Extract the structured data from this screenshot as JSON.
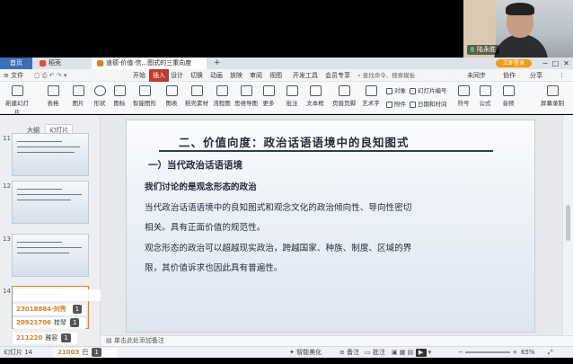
{
  "video": {
    "name": "陆永胜"
  },
  "tabs": {
    "home": "首页",
    "doke": "稻壳",
    "doc": "道德·价值·信...图式的三重向度",
    "plus": "+"
  },
  "login": "立即登录",
  "menu": {
    "file": "文件",
    "items": [
      "开始",
      "插入",
      "设计",
      "切换",
      "动画",
      "放映",
      "审阅",
      "视图",
      "开发工具",
      "会员专享"
    ],
    "search": "查找命令、搜索模板",
    "right": [
      "未同步",
      "协作",
      "分享"
    ]
  },
  "ribbon": {
    "large": [
      "新建幻灯片",
      "表格",
      "图片",
      "形状",
      "图标",
      "智能图形",
      "图表",
      "稻壳素材",
      "流程图",
      "思维导图",
      "更多",
      "批注",
      "文本框",
      "页眉页脚",
      "艺术字",
      "符号",
      "公式",
      "音频",
      "屏幕录制"
    ],
    "small": [
      "对象",
      "幻灯片编号",
      "附件",
      "日期和时间"
    ]
  },
  "leftpanel": {
    "tab_outline": "大纲",
    "tab_slides": "幻灯片",
    "nums": [
      "11",
      "12",
      "13",
      "14"
    ]
  },
  "chats": [
    {
      "name": "",
      "text": "",
      "count": "1"
    },
    {
      "name": "23018884·刘秀",
      "text": "",
      "count": "1"
    },
    {
      "name": "20921706",
      "text": "桂琴",
      "count": "1"
    },
    {
      "name": "211220",
      "text": "雅容",
      "count": "1"
    },
    {
      "name": "21003",
      "text": "巴",
      "count": "1"
    }
  ],
  "slide": {
    "title": "二、价值向度：政治话语语境中的良知图式",
    "subtitle": "一）当代政治话语语境",
    "lines": [
      "我们讨论的是观念形态的政治",
      "当代政治话语语境中的良知图式和观念文化的政治倾向性、导向性密切",
      "相关。具有正面价值的规范性。",
      "观念形态的政治可以超越现实政治，跨越国家、种族、制度、区域的界",
      "限，其价值诉求也因此具有普遍性。"
    ]
  },
  "notes": "单击此处添加备注",
  "status": {
    "left": "幻灯片 14",
    "smart": "智能美化",
    "notes": "备注",
    "comments": "批注",
    "zoom": "65%"
  }
}
